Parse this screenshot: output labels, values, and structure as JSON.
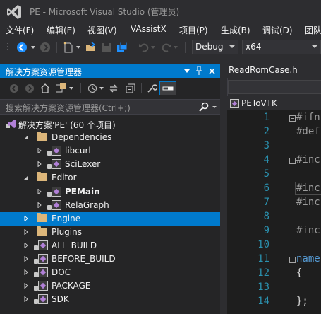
{
  "window": {
    "title": "PE - Microsoft Visual Studio (管理员)"
  },
  "menu": [
    "文件(F)",
    "编辑(E)",
    "视图(V)",
    "VAssistX",
    "项目(P)",
    "生成(B)",
    "调试(D)",
    "团队"
  ],
  "toolbar": {
    "configuration": "Debug",
    "platform": "x64"
  },
  "solution_explorer": {
    "title": "解决方案资源管理器",
    "search_placeholder": "搜索解决方案资源管理器(Ctrl+;)",
    "tree": [
      {
        "label": "解决方案'PE' (60 个项目)",
        "kind": "solution",
        "expanded": true,
        "indent": 0
      },
      {
        "label": "Dependencies",
        "kind": "folder",
        "expanded": true,
        "indent": 1
      },
      {
        "label": "libcurl",
        "kind": "project",
        "expanded": false,
        "indent": 2
      },
      {
        "label": "SciLexer",
        "kind": "project",
        "expanded": false,
        "indent": 2
      },
      {
        "label": "Editor",
        "kind": "folder",
        "expanded": true,
        "indent": 1
      },
      {
        "label": "PEMain",
        "kind": "project",
        "expanded": false,
        "indent": 2,
        "bold": true
      },
      {
        "label": "RelaGraph",
        "kind": "project",
        "expanded": false,
        "indent": 2
      },
      {
        "label": "Engine",
        "kind": "folder",
        "expanded": false,
        "indent": 1,
        "selected": true
      },
      {
        "label": "Plugins",
        "kind": "folder",
        "expanded": false,
        "indent": 1
      },
      {
        "label": "ALL_BUILD",
        "kind": "project",
        "expanded": false,
        "indent": 1
      },
      {
        "label": "BEFORE_BUILD",
        "kind": "project",
        "expanded": false,
        "indent": 1
      },
      {
        "label": "DOC",
        "kind": "project",
        "expanded": false,
        "indent": 1
      },
      {
        "label": "PACKAGE",
        "kind": "project",
        "expanded": false,
        "indent": 1
      },
      {
        "label": "SDK",
        "kind": "project",
        "expanded": false,
        "indent": 1
      }
    ]
  },
  "editor": {
    "tab": "ReadRomCase.h",
    "file_tab": "PEToVTK",
    "lines": [
      {
        "n": "1",
        "code": "#ifn"
      },
      {
        "n": "2",
        "code": "#def"
      },
      {
        "n": "3",
        "code": ""
      },
      {
        "n": "4",
        "code": "#inc"
      },
      {
        "n": "5",
        "code": ""
      },
      {
        "n": "6",
        "code": "#inc"
      },
      {
        "n": "7",
        "code": "#inc"
      },
      {
        "n": "8",
        "code": ""
      },
      {
        "n": "9",
        "code": "#inc"
      },
      {
        "n": "10",
        "code": ""
      },
      {
        "n": "11",
        "code": "name"
      },
      {
        "n": "12",
        "code": "{"
      },
      {
        "n": "13",
        "code": ""
      },
      {
        "n": "14",
        "code": "};"
      }
    ]
  },
  "colors": {
    "accent": "#007acc",
    "background": "#2d2d30",
    "panel": "#252526",
    "editor": "#1e1e1e",
    "line_number": "#2b91af",
    "keyword": "#569cd6",
    "preprocessor": "#9b9b9b",
    "folder": "#dcb67a"
  }
}
